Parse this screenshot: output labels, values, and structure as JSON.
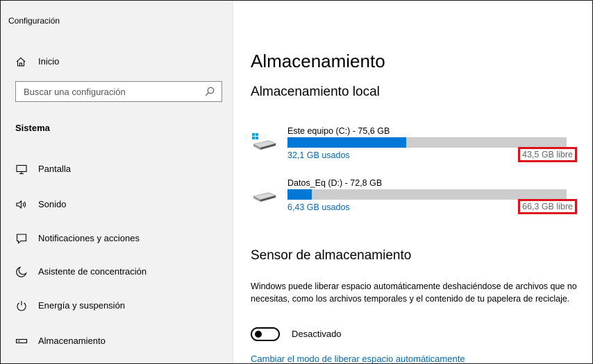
{
  "app": {
    "title": "Configuración"
  },
  "sidebar": {
    "home_label": "Inicio",
    "search": {
      "placeholder": "Buscar una configuración",
      "value": ""
    },
    "section_title": "Sistema",
    "items": [
      {
        "label": "Pantalla",
        "icon": "monitor-icon"
      },
      {
        "label": "Sonido",
        "icon": "speaker-icon"
      },
      {
        "label": "Notificaciones y acciones",
        "icon": "notification-icon"
      },
      {
        "label": "Asistente de concentración",
        "icon": "moon-icon"
      },
      {
        "label": "Energía y suspensión",
        "icon": "power-icon"
      },
      {
        "label": "Almacenamiento",
        "icon": "storage-icon"
      }
    ]
  },
  "main": {
    "title": "Almacenamiento",
    "local_title": "Almacenamiento local",
    "drives": [
      {
        "name": "Este equipo (C:) - 75,6 GB",
        "used": "32,1 GB usados",
        "free": "43,5 GB libre",
        "used_fraction": 0.425,
        "icon": "windows-drive-icon"
      },
      {
        "name": "Datos_Eq (D:) - 72,8 GB",
        "used": "6,43 GB usados",
        "free": "66,3 GB libre",
        "used_fraction": 0.088,
        "icon": "drive-icon"
      }
    ],
    "sensor": {
      "title": "Sensor de almacenamiento",
      "description": "Windows puede liberar espacio automáticamente deshaciéndose de archivos que no necesitas, como los archivos temporales y el contenido de tu papelera de reciclaje.",
      "toggle_label": "Desactivado",
      "toggle_on": false,
      "link": "Cambiar el modo de liberar espacio automáticamente"
    }
  },
  "colors": {
    "accent": "#0078d7",
    "link": "#0067b8",
    "highlight": "#e0101a",
    "sidebar_bg": "#f2f2f2",
    "bar_bg": "#cccccc"
  }
}
